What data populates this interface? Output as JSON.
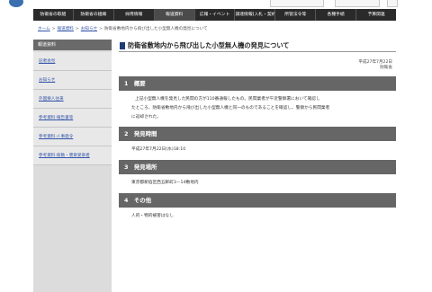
{
  "global_nav": {
    "items": [
      {
        "label": "防衛省の取組"
      },
      {
        "label": "防衛省の組織"
      },
      {
        "label": "採用情報"
      },
      {
        "label": "報道資料"
      },
      {
        "label": "広報・イベント"
      },
      {
        "label": "調達情報(入札・契約)"
      },
      {
        "label": "所管法令等"
      },
      {
        "label": "各種手続"
      },
      {
        "label": "予算関連"
      }
    ]
  },
  "breadcrumb": {
    "items": [
      "ホーム",
      "報道資料",
      "お知らせ"
    ],
    "current": "防衛省敷地内から飛び出した小型無人機の発見について",
    "separator": ">"
  },
  "sidebar": {
    "heading": "報道資料",
    "items": [
      {
        "label": "記者会見"
      },
      {
        "label": "お知らせ"
      },
      {
        "label": "外国要人往来"
      },
      {
        "label": "参考資料:報告書等"
      },
      {
        "label": "参考資料:人事発令"
      },
      {
        "label": "参考資料:叙勲・褒章受章者"
      }
    ]
  },
  "main": {
    "title": "防衛省敷地内から飛び出した小型無人機の発見について",
    "date": "平成27年7月22日",
    "org": "防衛省",
    "sections": [
      {
        "heading": "1　概要",
        "lines": [
          "上記小型無人機を発見した民間の方が110番通報したもの。民間業者が午近警察署において確認し",
          "たところ、防衛省敷地内から飛び出した小型無人機と同一のものであることを確認し、警察から民間業者",
          "に返却された。"
        ]
      },
      {
        "heading": "2　発見時間",
        "lines": [
          "平成27年7月22日(水)18:10"
        ]
      },
      {
        "heading": "3　発見場所",
        "lines": [
          "東京都新宿区西五軒町3－14敷地内"
        ]
      },
      {
        "heading": "4　その他",
        "lines": [
          "人的・物的被害はなし"
        ]
      }
    ]
  },
  "colors": {
    "nav_bg": "#2a2a2a",
    "section_header_bg": "#666666",
    "sidebar_bg": "#dcdcdc",
    "title_marker": "#1e3c78",
    "link": "#3355aa"
  }
}
